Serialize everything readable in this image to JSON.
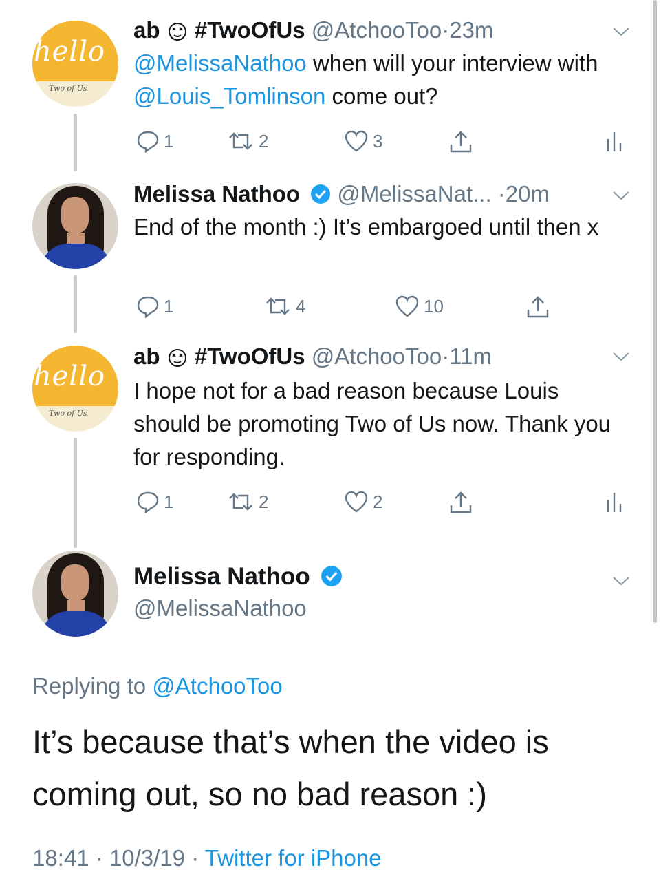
{
  "tweets": [
    {
      "name": "ab",
      "emoji": "dizzy-face",
      "hashtag": "#TwoOfUs",
      "handle": "@AtchooToo",
      "dot": "·",
      "time": "23m",
      "avatar": {
        "word": "hello",
        "sub": "Two of Us"
      },
      "text_parts": [
        {
          "t": "@MelissaNathoo",
          "link": true
        },
        {
          "t": " when will your interview with ",
          "link": false
        },
        {
          "t": "@Louis_Tomlinson",
          "link": true
        },
        {
          "t": " come out?",
          "link": false
        }
      ],
      "replies": "1",
      "retweets": "2",
      "likes": "3",
      "show_analytics": true
    },
    {
      "name": "Melissa Nathoo",
      "verified": true,
      "handle": "@MelissaNat...",
      "dot": "·",
      "time": "20m",
      "text": "End of the month :) It’s embargoed until then x",
      "replies": "1",
      "retweets": "4",
      "likes": "10",
      "show_analytics": false
    },
    {
      "name": "ab",
      "emoji": "dizzy-face",
      "hashtag": "#TwoOfUs",
      "handle": "@AtchooToo",
      "dot": "·",
      "time": "11m",
      "avatar": {
        "word": "hello",
        "sub": "Two of Us"
      },
      "text": "I hope not for a bad reason because Louis should be promoting Two of Us now. Thank you for responding.",
      "replies": "1",
      "retweets": "2",
      "likes": "2",
      "show_analytics": true
    }
  ],
  "focus": {
    "name": "Melissa Nathoo",
    "verified": true,
    "handle": "@MelissaNathoo",
    "replying_prefix": "Replying to",
    "replying_to": "@AtchooToo",
    "text": "It’s because that’s when the video is coming out, so no bad reason :)",
    "time": "18:41",
    "sep1": "·",
    "date": "10/3/19",
    "sep2": "·",
    "client": "Twitter for iPhone"
  },
  "colors": {
    "link": "#1b95e0",
    "muted": "#657786",
    "text": "#14171a",
    "verified": "#1da1f2"
  }
}
